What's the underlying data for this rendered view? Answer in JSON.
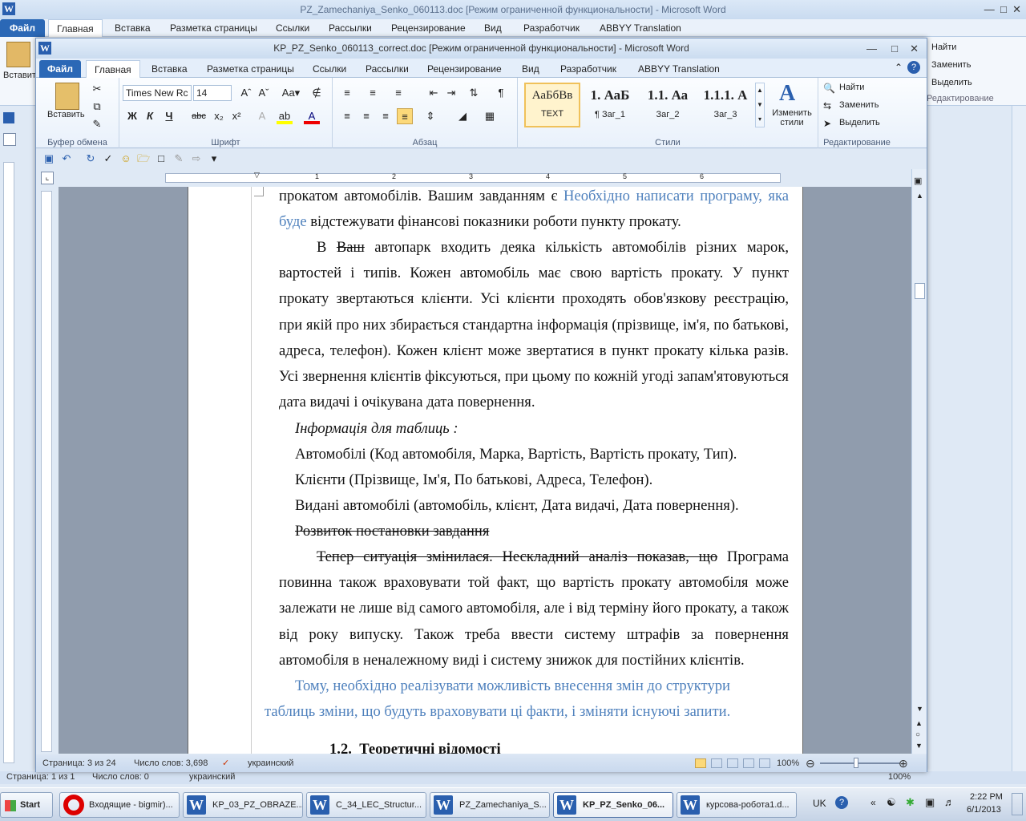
{
  "back_window": {
    "title": "PZ_Zamechaniya_Senko_060113.doc [Режим ограниченной функциональности] - Microsoft Word",
    "tabs": [
      "Файл",
      "Главная",
      "Вставка",
      "Разметка страницы",
      "Ссылки",
      "Рассылки",
      "Рецензирование",
      "Вид",
      "Разработчик",
      "ABBYY Translation"
    ],
    "find": "Найти",
    "replace": "Заменить",
    "select": "Выделить",
    "edit_group": "Редактирование",
    "insert_label": "Вставить",
    "status_page": "Страница: 1 из 1",
    "status_words": "Число слов: 0",
    "status_lang": "украинский",
    "zoom": "100%"
  },
  "window": {
    "title": "KP_PZ_Senko_060113_correct.doc [Режим ограниченной функциональности] - Microsoft Word"
  },
  "tabs": [
    "Файл",
    "Главная",
    "Вставка",
    "Разметка страницы",
    "Ссылки",
    "Рассылки",
    "Рецензирование",
    "Вид",
    "Разработчик",
    "ABBYY Translation"
  ],
  "ribbon": {
    "clipboard": {
      "paste": "Вставить",
      "label": "Буфер обмена"
    },
    "font": {
      "name": "Times New Rc",
      "size": "14",
      "label": "Шрифт",
      "bold": "Ж",
      "italic": "К",
      "underline": "Ч",
      "strike": "abc",
      "sub": "x₂",
      "sup": "x²"
    },
    "paragraph": {
      "label": "Абзац"
    },
    "styles": {
      "label": "Стили",
      "items": [
        {
          "sample": "АаБбВв",
          "name": "TEXT"
        },
        {
          "sample": "1. АаБ",
          "name": "¶ Заг_1"
        },
        {
          "sample": "1.1. Аа",
          "name": "Заг_2"
        },
        {
          "sample": "1.1.1. А",
          "name": "Заг_3"
        }
      ],
      "change": "Изменить стили"
    },
    "editing": {
      "label": "Редактирование",
      "find": "Найти",
      "replace": "Заменить",
      "select": "Выделить"
    }
  },
  "ruler": {
    "marks": [
      "1",
      "2",
      "3",
      "4",
      "5",
      "6"
    ]
  },
  "document": {
    "p0a": "прокатом автомобілів. Вашим завданням є",
    "p0b": "Необхідно написати програму, яка",
    "p0c": "буде",
    "p0d": "відстежувати фінансові показники роботи пункту прокату.",
    "p1_strike": "Ваш",
    "p1_pre": "В",
    "p1_rest": "автопарк входить деяка кількість автомобілів різних марок, вартостей і типів. Кожен автомобіль має свою вартість прокату. У пункт прокату звертаються клієнти. Усі клієнти проходять обов'язкову реєстрацію, при якій про них збирається стандартна інформація (прізвище, ім'я, по батькові, адреса, телефон). Кожен клієнт може звертатися в пункт прокату кілька разів. Усі звернення клієнтів фіксуються, при цьому по кожній угоді запам'ятовуються дата видачі і очікувана дата повернення.",
    "info": "Інформація для таблиць :",
    "t1": "Автомобілі (Код автомобіля, Марка, Вартість, Вартість прокату, Тип).",
    "t2": "Клієнти (Прізвище, Ім'я, По батькові, Адреса, Телефон).",
    "t3": "Видані автомобілі (автомобіль, клієнт, Дата видачі, Дата повернення).",
    "dev": "Розвиток постановки завдання",
    "p2_strike": "Тепер ситуація змінилася. Нескладний аналіз показав, що",
    "p2_rest": "Програма повинна також враховувати  той факт, що вартість прокату автомобіля може залежати не лише від самого автомобіля, але і від терміну його прокату, а також від року випуску. Також треба ввести систему штрафів за повернення автомобіля в неналежному виді і систему знижок для постійних клієнтів.",
    "p3": "Тому, необхідно реалізувати можливість внесення змін  до структури таблиць зміни, що будуть враховувати ці факти, і зміняти існуючі запити.",
    "h_num": "1.2.",
    "h_text": "Теоретичні відомості"
  },
  "status": {
    "page": "Страница: 3 из 24",
    "words": "Число слов: 3,698",
    "lang": "украинский",
    "zoom": "100%"
  },
  "taskbar": {
    "start": "Start",
    "items": [
      "Входящие - bigmir)...",
      "KP_03_PZ_OBRAZE...",
      "C_34_LEC_Structur...",
      "PZ_Zamechaniya_S...",
      "KP_PZ_Senko_06...",
      "курсова-робота1.d..."
    ],
    "lang": "UK",
    "time": "2:22 PM",
    "date": "6/1/2013"
  },
  "colors": {
    "accent": "#2b68b6",
    "link_blue": "#4f81bd"
  }
}
